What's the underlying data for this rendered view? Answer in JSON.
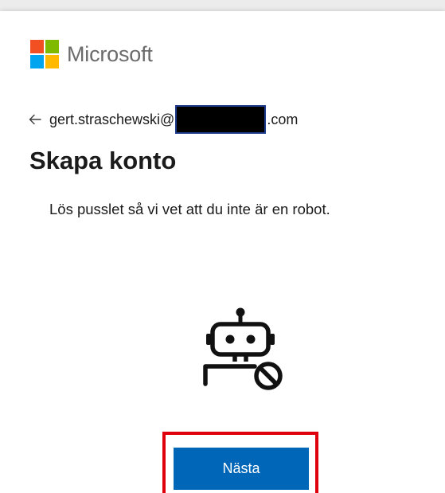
{
  "brand": {
    "name": "Microsoft",
    "logo_colors": [
      "#f25022",
      "#7fba00",
      "#00a4ef",
      "#ffb900"
    ]
  },
  "identity": {
    "back_icon": "arrow-left-icon",
    "email_prefix": "gert.straschewski@",
    "email_suffix": ".com"
  },
  "title": "Skapa konto",
  "instruction": "Lös pusslet så vi vet att du inte är en robot.",
  "challenge_icon": "robot-blocked-icon",
  "next_button": {
    "label": "Nästa",
    "color": "#0067b8",
    "highlight_color": "#e0000b"
  }
}
